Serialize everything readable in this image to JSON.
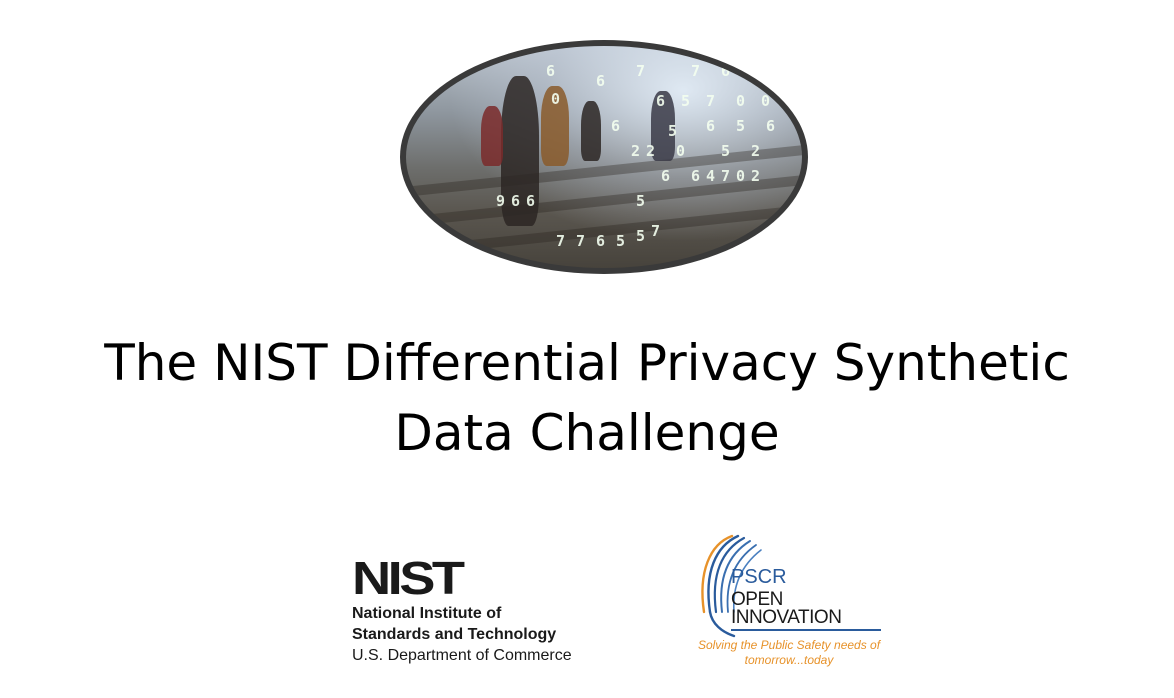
{
  "slide": {
    "title_line1": "The NIST Differential Privacy Synthetic",
    "title_line2": "Data Challenge"
  },
  "hero_image": {
    "icon": "people-walking-data-overlay-image",
    "digits": [
      "6",
      "0",
      "6",
      "6",
      "7",
      "6",
      "5",
      "5",
      "7",
      "7",
      "6",
      "6",
      "5",
      "0",
      "5",
      "6",
      "2",
      "0",
      "2",
      "2",
      "6",
      "0",
      "6",
      "4",
      "7",
      "0",
      "2",
      "6",
      "9",
      "6",
      "6",
      "5",
      "7",
      "7",
      "6",
      "5",
      "5",
      "7"
    ]
  },
  "nist_logo": {
    "wordmark": "NIST",
    "line1": "National Institute of",
    "line2": "Standards and Technology",
    "line3": "U.S. Department of Commerce"
  },
  "pscr_logo": {
    "brand": "PSCR",
    "open": "OPEN",
    "innovation": "INNOVATION",
    "tagline": "Solving the Public Safety needs of tomorrow...today",
    "colors": {
      "blue": "#2a5b9c",
      "orange": "#e7922a"
    }
  }
}
